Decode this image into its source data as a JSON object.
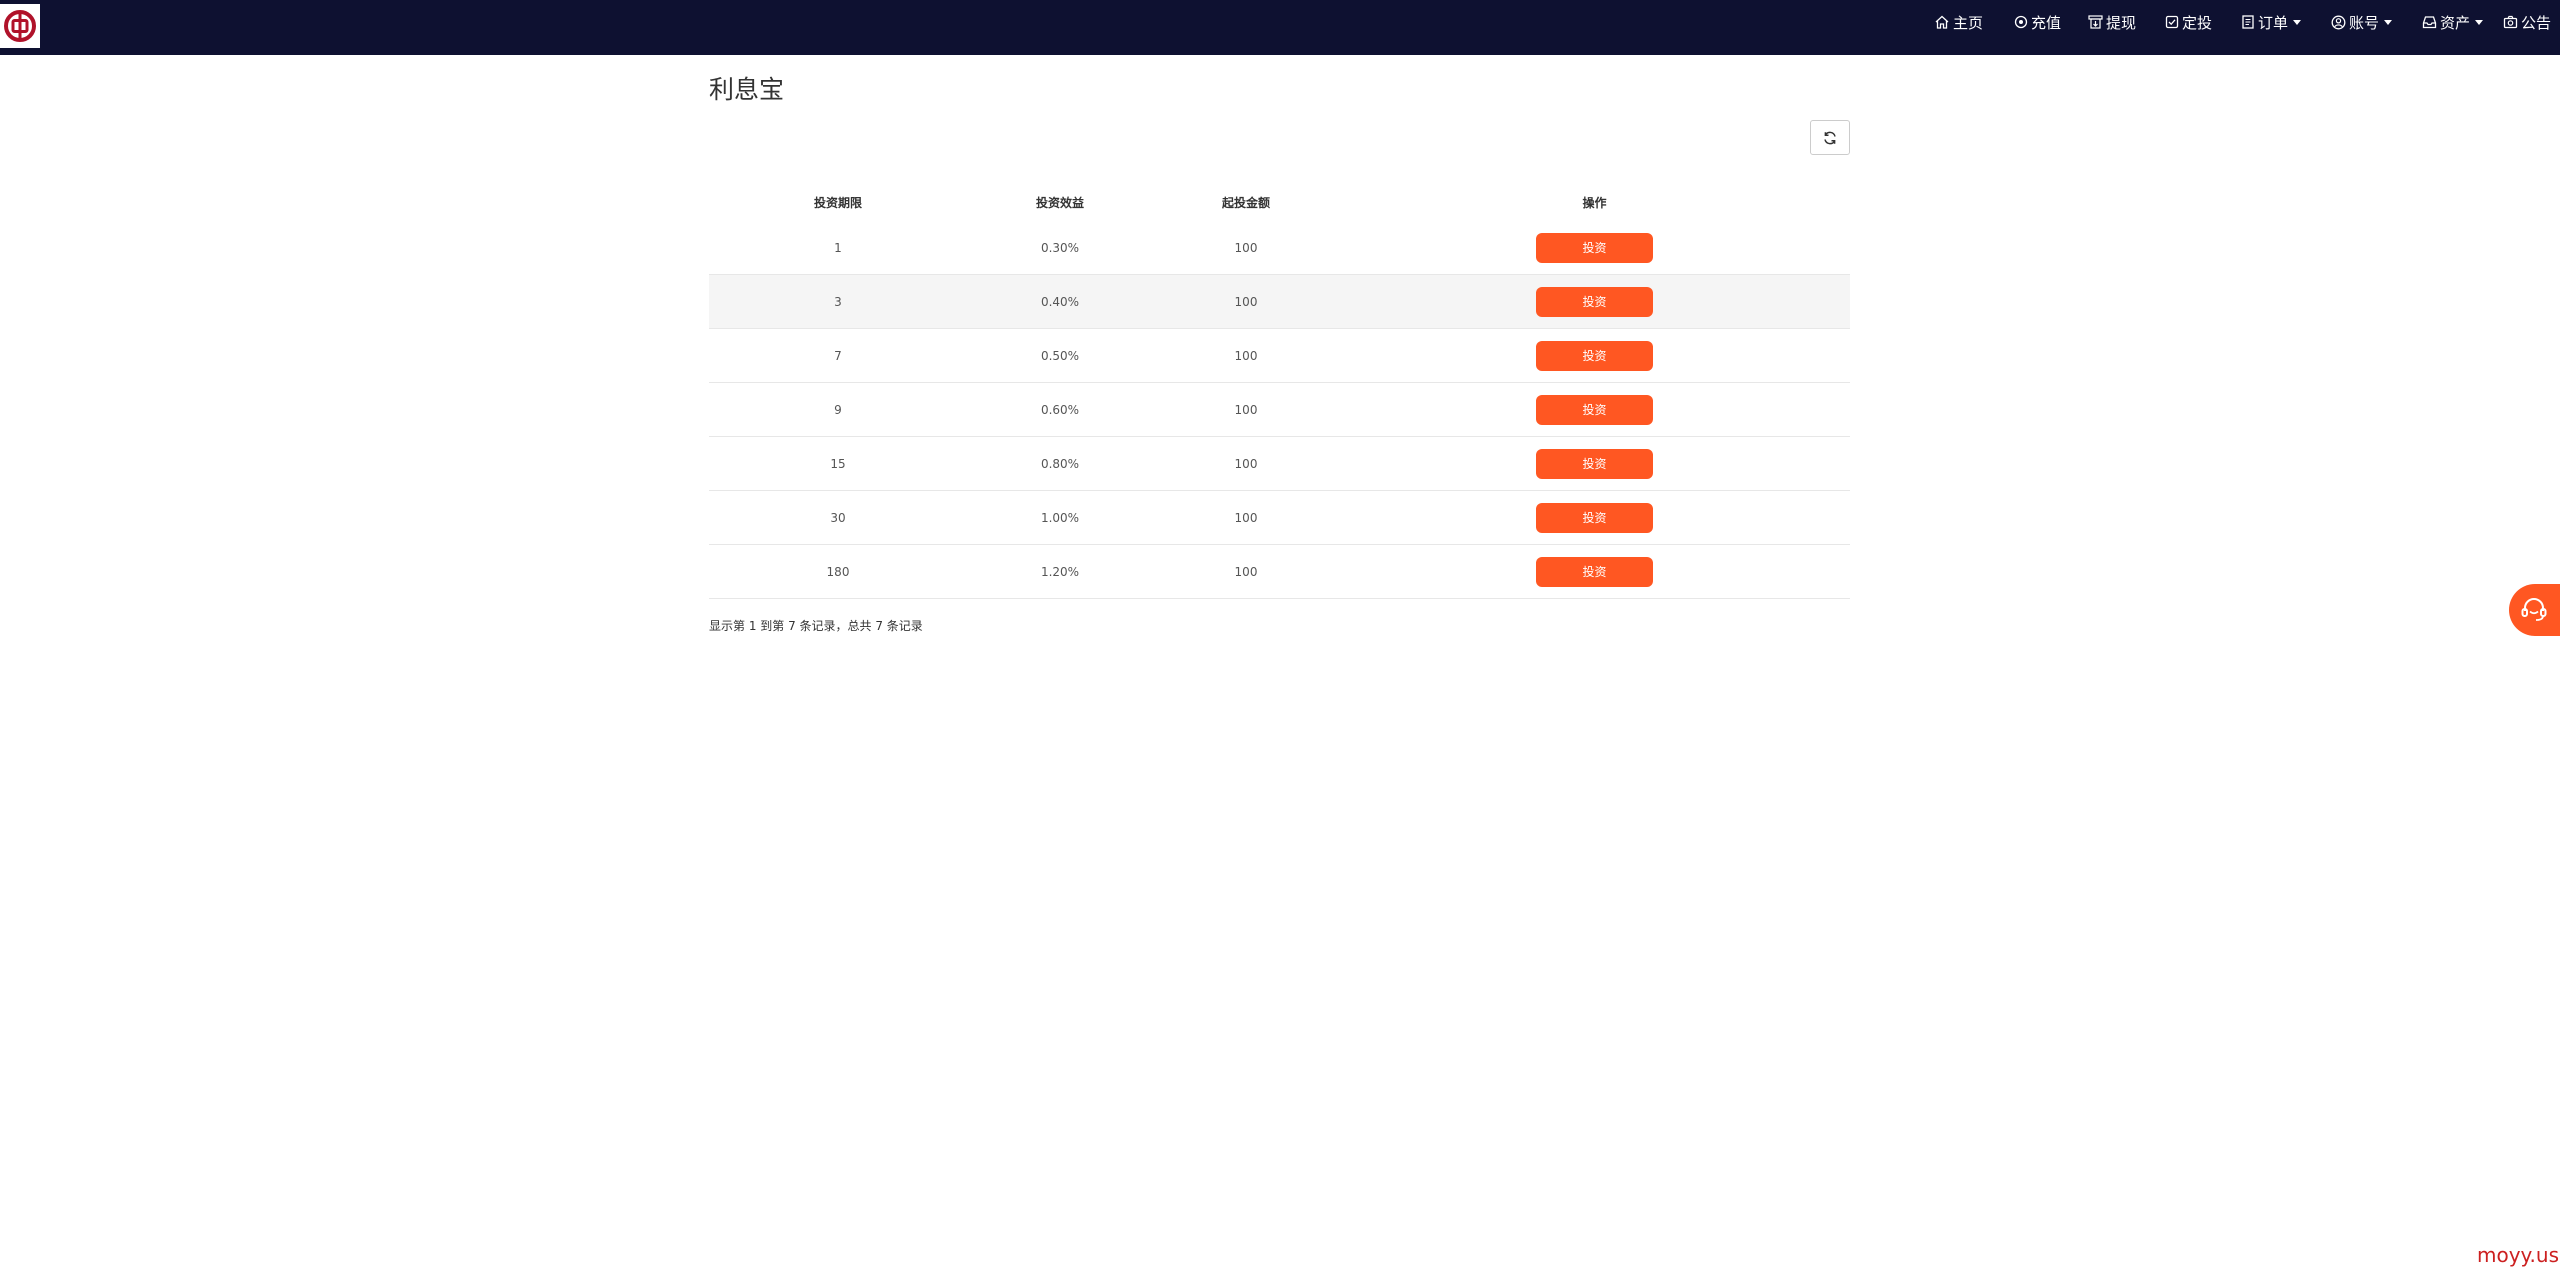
{
  "nav": {
    "home": "主页",
    "recharge": "充值",
    "withdraw": "提现",
    "fixed_invest": "定投",
    "orders": "订单",
    "account": "账号",
    "assets": "资产",
    "notice": "公告"
  },
  "page": {
    "title": "利息宝"
  },
  "table": {
    "headers": [
      "投资期限",
      "投资效益",
      "起投金额",
      "操作"
    ],
    "rows": [
      {
        "term": "1",
        "yield": "0.30%",
        "min_amount": "100",
        "action": "投资"
      },
      {
        "term": "3",
        "yield": "0.40%",
        "min_amount": "100",
        "action": "投资"
      },
      {
        "term": "7",
        "yield": "0.50%",
        "min_amount": "100",
        "action": "投资"
      },
      {
        "term": "9",
        "yield": "0.60%",
        "min_amount": "100",
        "action": "投资"
      },
      {
        "term": "15",
        "yield": "0.80%",
        "min_amount": "100",
        "action": "投资"
      },
      {
        "term": "30",
        "yield": "1.00%",
        "min_amount": "100",
        "action": "投资"
      },
      {
        "term": "180",
        "yield": "1.20%",
        "min_amount": "100",
        "action": "投资"
      }
    ]
  },
  "pagination": {
    "summary": "显示第 1 到第 7 条记录，总共 7 条记录"
  },
  "watermark": "moyy.us",
  "colors": {
    "navbar_bg": "#0e1131",
    "accent": "#ff5722",
    "striped_row": "#f5f5f5"
  }
}
